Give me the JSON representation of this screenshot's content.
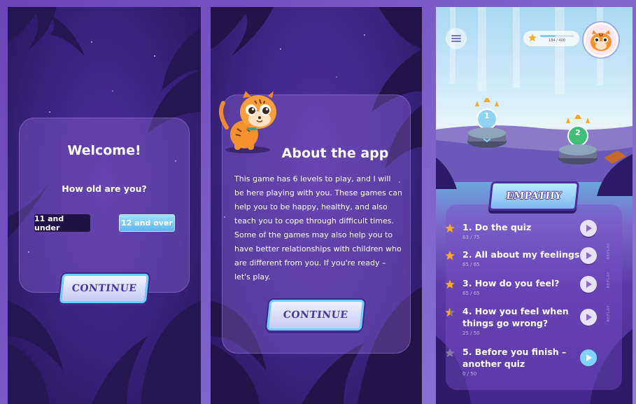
{
  "screens": {
    "welcome": {
      "title": "Welcome!",
      "question": "How old are you?",
      "options": [
        "11 and under",
        "12 and over"
      ],
      "selected_option": "12 and over",
      "continue_label": "CONTINUE"
    },
    "about": {
      "title": "About the app",
      "body": "This game has 6 levels to play, and I will be here playing with you. These games can help you to be happy, healthy, and also teach you to cope through difficult times. Some of the games may also help you to have better relationships with children who are different from you. If you're ready – let's play.",
      "continue_label": "CONTINUE"
    },
    "levels": {
      "score_text": "184 / 400",
      "score_progress": 0.46,
      "section_title": "EMPATHY",
      "pedestals": [
        "1",
        "2"
      ],
      "replay_label": "REPLAY",
      "items": [
        {
          "name": "1. Do the quiz",
          "score": "63 / 75",
          "replay": false,
          "star": "gold"
        },
        {
          "name": "2. All about my feelings",
          "score": "65 / 65",
          "replay": true,
          "star": "gold"
        },
        {
          "name": "3. How do you feel?",
          "score": "65 / 65",
          "replay": true,
          "star": "gold"
        },
        {
          "name": "4. How you feel when things go wrong?",
          "score": "25 / 50",
          "replay": true,
          "star": "half"
        },
        {
          "name": "5. Before you finish – another quiz",
          "score": "0 / 50",
          "replay": false,
          "star": "grey"
        }
      ]
    }
  },
  "colors": {
    "accent_blue": "#6ed0ff",
    "star_gold": "#f7a928",
    "panel_purple": "#3a2480"
  }
}
